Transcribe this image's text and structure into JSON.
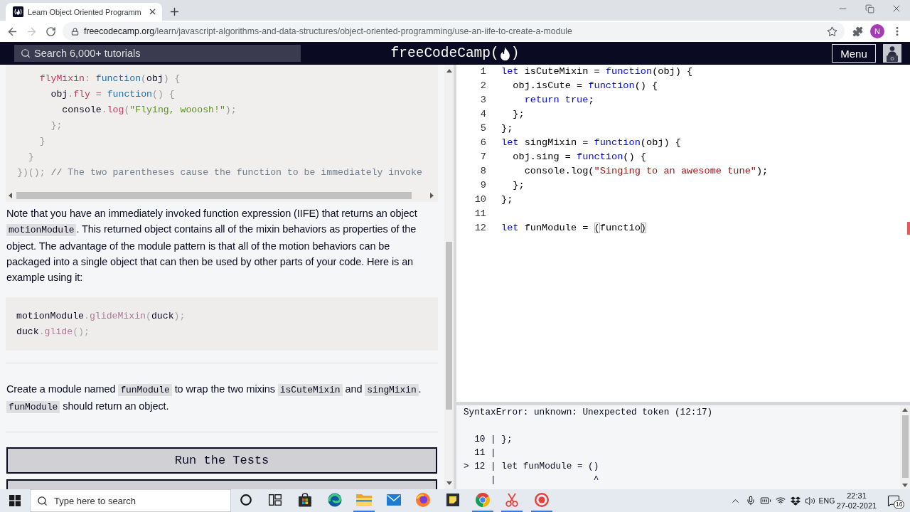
{
  "browser": {
    "tab": {
      "title": "Learn Object Oriented Programm"
    },
    "back_disabled": false,
    "forward_disabled": true,
    "address": {
      "host": "freecodecamp.org",
      "path": "/learn/javascript-algorithms-and-data-structures/object-oriented-programming/use-an-iife-to-create-a-module"
    },
    "profile_initial": "N"
  },
  "navbar": {
    "search": {
      "placeholder": "Search 6,000+ tutorials"
    },
    "logo": {
      "text": "freeCodeCamp(",
      "end": ")"
    },
    "menu": "Menu"
  },
  "lesson": {
    "content": [
      {
        "kind": "code",
        "lines": [
          [
            {
              "kind": "property",
              "text": "    flyMixin"
            },
            {
              "kind": "punct",
              "text": ": "
            },
            {
              "kind": "keyword",
              "text": "function"
            },
            {
              "kind": "punct",
              "text": "("
            },
            {
              "kind": "plain",
              "text": "obj"
            },
            {
              "kind": "punct",
              "text": ") {"
            }
          ],
          [
            {
              "kind": "plain",
              "text": "      obj"
            },
            {
              "kind": "punct",
              "text": "."
            },
            {
              "kind": "property",
              "text": "fly"
            },
            {
              "kind": "operator",
              "text": " = "
            },
            {
              "kind": "keyword",
              "text": "function"
            },
            {
              "kind": "punct",
              "text": "() {"
            }
          ],
          [
            {
              "kind": "plain",
              "text": "        console"
            },
            {
              "kind": "punct",
              "text": "."
            },
            {
              "kind": "function",
              "text": "log"
            },
            {
              "kind": "punct",
              "text": "("
            },
            {
              "kind": "string",
              "text": "\"Flying, wooosh!\""
            },
            {
              "kind": "punct",
              "text": ");"
            }
          ],
          [
            {
              "kind": "punct",
              "text": "      };"
            }
          ],
          [
            {
              "kind": "punct",
              "text": "    }"
            }
          ],
          [
            {
              "kind": "punct",
              "text": "  }"
            }
          ],
          [
            {
              "kind": "punct",
              "text": "})();"
            },
            {
              "kind": "comment",
              "text": " // The two parentheses cause the function to be immediately invoke"
            }
          ]
        ]
      },
      {
        "kind": "text",
        "segments": [
          {
            "kind": "text",
            "text": "Note that you have an immediately invoked function expression (IIFE) that returns an object "
          },
          {
            "kind": "code",
            "text": "motionModule"
          },
          {
            "kind": "text",
            "text": ". This returned object contains all of the mixin behaviors as properties of the object. The advantage of the module pattern is that all of the motion behaviors can be packaged into a single object that can then be used by other parts of your code. Here is an example using it:"
          }
        ]
      },
      {
        "kind": "example",
        "lines": [
          [
            {
              "kind": "plain",
              "text": "motionModule"
            },
            {
              "kind": "punct",
              "text": "."
            },
            {
              "kind": "function",
              "text": "glideMixin"
            },
            {
              "kind": "punct",
              "text": "("
            },
            {
              "kind": "plain",
              "text": "duck"
            },
            {
              "kind": "punct",
              "text": ");"
            }
          ],
          [
            {
              "kind": "plain",
              "text": "duck"
            },
            {
              "kind": "punct",
              "text": "."
            },
            {
              "kind": "function",
              "text": "glide"
            },
            {
              "kind": "punct",
              "text": "();"
            }
          ]
        ]
      },
      {
        "kind": "instructions",
        "segments": [
          {
            "kind": "text",
            "text": "Create a module named "
          },
          {
            "kind": "code",
            "text": "funModule"
          },
          {
            "kind": "text",
            "text": " to wrap the two mixins "
          },
          {
            "kind": "code",
            "text": "isCuteMixin"
          },
          {
            "kind": "text",
            "text": " and "
          },
          {
            "kind": "code",
            "text": "singMixin"
          },
          {
            "kind": "text",
            "text": ". "
          },
          {
            "kind": "code",
            "text": "funModule"
          },
          {
            "kind": "text",
            "text": " should return an object."
          }
        ]
      }
    ],
    "buttons": [
      {
        "kind": "full",
        "label": "Run the Tests"
      },
      {
        "kind": "cut"
      }
    ]
  },
  "editor": {
    "lines": [
      {
        "number": "1",
        "error": false,
        "tokens": [
          {
            "kind": "keyword",
            "text": "let"
          },
          {
            "kind": "plain",
            "text": " isCuteMixin = "
          },
          {
            "kind": "keyword",
            "text": "function"
          },
          {
            "kind": "plain",
            "text": "(obj) {"
          }
        ]
      },
      {
        "number": "2",
        "error": false,
        "tokens": [
          {
            "kind": "plain",
            "text": "  obj.isCute = "
          },
          {
            "kind": "keyword",
            "text": "function"
          },
          {
            "kind": "plain",
            "text": "() {"
          }
        ]
      },
      {
        "number": "3",
        "error": false,
        "tokens": [
          {
            "kind": "keyword",
            "text": "    return true"
          },
          {
            "kind": "plain",
            "text": ";"
          }
        ]
      },
      {
        "number": "4",
        "error": false,
        "tokens": [
          {
            "kind": "plain",
            "text": "  };"
          }
        ]
      },
      {
        "number": "5",
        "error": false,
        "tokens": [
          {
            "kind": "plain",
            "text": "};"
          }
        ]
      },
      {
        "number": "6",
        "error": false,
        "tokens": [
          {
            "kind": "keyword",
            "text": "let"
          },
          {
            "kind": "plain",
            "text": " singMixin = "
          },
          {
            "kind": "keyword",
            "text": "function"
          },
          {
            "kind": "plain",
            "text": "(obj) {"
          }
        ]
      },
      {
        "number": "7",
        "error": false,
        "tokens": [
          {
            "kind": "plain",
            "text": "  obj.sing = "
          },
          {
            "kind": "keyword",
            "text": "function"
          },
          {
            "kind": "plain",
            "text": "() {"
          }
        ]
      },
      {
        "number": "8",
        "error": false,
        "tokens": [
          {
            "kind": "plain",
            "text": "    console.log("
          },
          {
            "kind": "string",
            "text": "\"Singing to an awesome tune\""
          },
          {
            "kind": "plain",
            "text": ");"
          }
        ]
      },
      {
        "number": "9",
        "error": false,
        "tokens": [
          {
            "kind": "plain",
            "text": "  };"
          }
        ]
      },
      {
        "number": "10",
        "error": false,
        "tokens": [
          {
            "kind": "plain",
            "text": "};"
          }
        ]
      },
      {
        "number": "11",
        "error": false
      },
      {
        "number": "12",
        "error": true,
        "tokens": [
          {
            "kind": "keyword",
            "text": "let"
          },
          {
            "kind": "plain",
            "text": " funModule = "
          },
          {
            "kind": "bracket",
            "text": "("
          },
          {
            "kind": "plain",
            "text": "functio"
          },
          {
            "kind": "caret-bracket",
            "text": ")"
          }
        ]
      }
    ]
  },
  "console": {
    "lines": [
      {
        "kind": "message",
        "text": "SyntaxError: unknown: Unexpected token (12:17)"
      },
      {
        "kind": "frame",
        "text": "  10 | };"
      },
      {
        "kind": "frame",
        "text": "  11 |"
      },
      {
        "kind": "frame",
        "text": "> 12 | let funModule = ()"
      },
      {
        "kind": "frame",
        "text": "     |                  ^"
      }
    ]
  },
  "taskbar": {
    "search": {
      "placeholder": "Type here to search"
    },
    "apps": [
      {
        "kind": "bag",
        "running": false
      },
      {
        "kind": "swirl",
        "running": false
      },
      {
        "kind": "folder",
        "running": true
      },
      {
        "kind": "envelope",
        "running": false
      },
      {
        "kind": "circles",
        "running": false
      },
      {
        "kind": "note",
        "running": false
      },
      {
        "kind": "segmented",
        "running": true
      },
      {
        "kind": "scissors",
        "running": true
      },
      {
        "kind": "record",
        "running": true
      }
    ],
    "language": "ENG",
    "time": "22:31",
    "date": "27-02-2021",
    "notifications": "16"
  }
}
